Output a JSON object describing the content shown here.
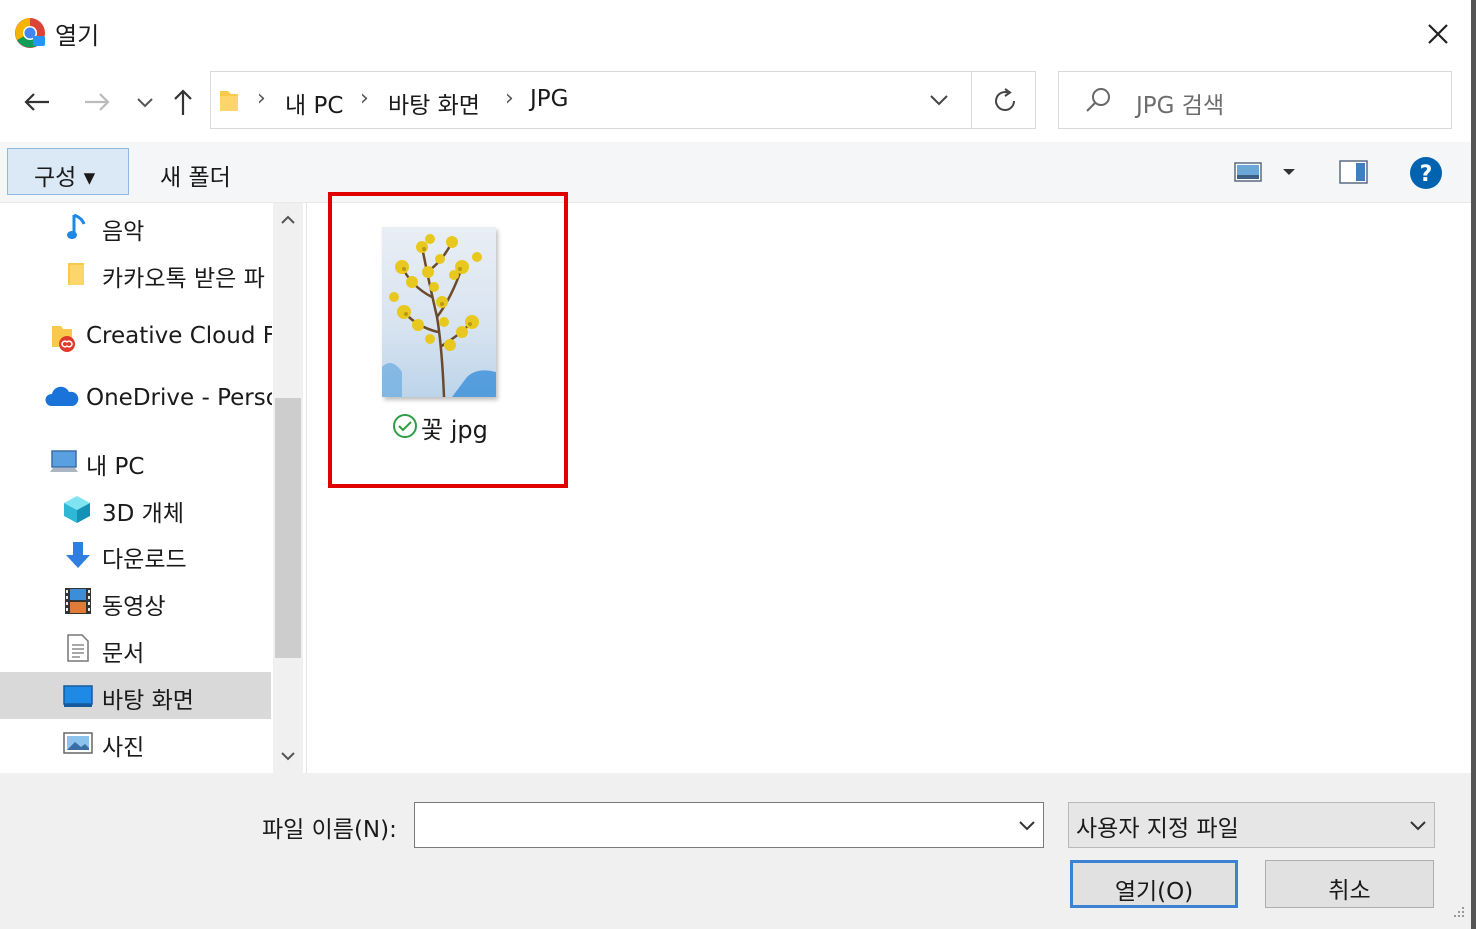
{
  "window": {
    "title": "열기",
    "close_glyph": "✕"
  },
  "nav": {
    "back_glyph": "←",
    "forward_glyph": "→",
    "recent_glyph": "⌄",
    "up_glyph": "↑",
    "breadcrumb": [
      "내 PC",
      "바탕 화면",
      "JPG"
    ],
    "refresh_glyph": "↻"
  },
  "search": {
    "placeholder": "JPG 검색"
  },
  "toolbar": {
    "organize_label": "구성 ▾",
    "new_folder_label": "새 폴더",
    "help_glyph": "?"
  },
  "sidebar": {
    "items": [
      {
        "label": "음악",
        "icon": "music-note-icon"
      },
      {
        "label": "카카오톡 받은 파",
        "icon": "folder-icon"
      },
      {
        "label": "Creative Cloud Fil",
        "icon": "creative-cloud-folder-icon"
      },
      {
        "label": "OneDrive - Perso",
        "icon": "onedrive-cloud-icon"
      },
      {
        "label": "내 PC",
        "icon": "computer-icon"
      },
      {
        "label": "3D 개체",
        "icon": "cube-3d-icon"
      },
      {
        "label": "다운로드",
        "icon": "download-arrow-icon"
      },
      {
        "label": "동영상",
        "icon": "film-icon"
      },
      {
        "label": "문서",
        "icon": "document-icon"
      },
      {
        "label": "바탕 화면",
        "icon": "desktop-icon",
        "selected": true
      },
      {
        "label": "사진",
        "icon": "pictures-icon"
      }
    ]
  },
  "files": [
    {
      "name": "꽃 jpg",
      "status_icon": "sync-check-icon"
    }
  ],
  "bottom": {
    "filename_label": "파일 이름(N):",
    "filename_value": "",
    "filter_value": "사용자 지정 파일",
    "open_label": "열기(O)",
    "cancel_label": "취소"
  },
  "colors": {
    "highlight": "#e00000",
    "accent": "#0063b1",
    "selected": "#d9d9d9"
  }
}
